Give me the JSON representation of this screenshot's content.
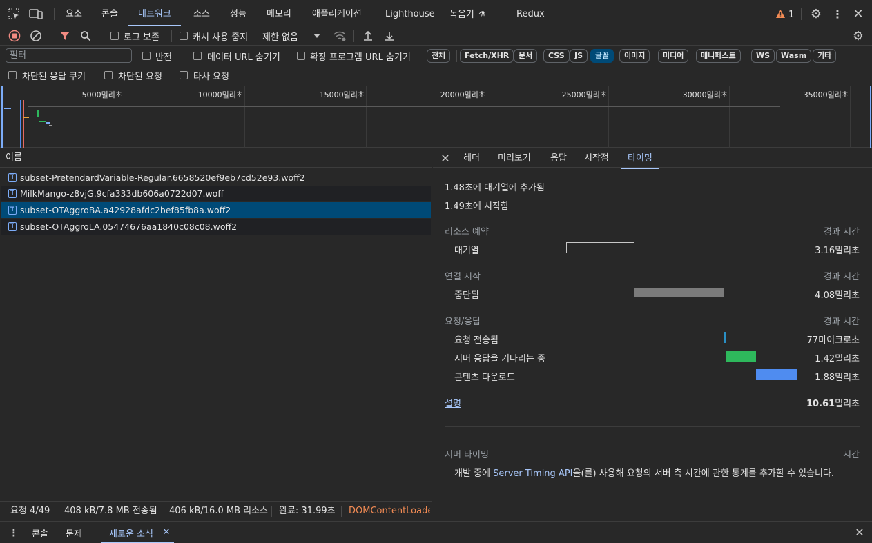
{
  "top_tabs": [
    "요소",
    "콘솔",
    "네트워크",
    "소스",
    "성능",
    "메모리",
    "애플리케이션",
    "Lighthouse",
    "녹음기",
    "Redux"
  ],
  "warning_count": "1",
  "toolbar": {
    "preserve_log": "로그 보존",
    "disable_cache": "캐시 사용 중지",
    "throttling": "제한 없음"
  },
  "filter": {
    "placeholder": "필터",
    "invert": "반전",
    "hide_data_urls": "데이터 URL 숨기기",
    "hide_ext_urls": "확장 프로그램 URL 숨기기",
    "types": [
      "전체",
      "Fetch/XHR",
      "문서",
      "CSS",
      "JS",
      "글꼴",
      "이미지",
      "미디어",
      "매니페스트",
      "WS",
      "Wasm",
      "기타"
    ],
    "selected_type": "글꼴",
    "blocked_cookies": "차단된 응답 쿠키",
    "blocked_requests": "차단된 요청",
    "third_party": "타사 요청"
  },
  "overview_ticks": [
    "5000밀리초",
    "10000밀리초",
    "15000밀리초",
    "20000밀리초",
    "25000밀리초",
    "30000밀리초",
    "35000밀리초"
  ],
  "list": {
    "header": "이름",
    "rows": [
      "subset-PretendardVariable-Regular.6658520ef9eb7cd52e93.woff2",
      "MilkMango-z8vjG.9cfa333db606a0722d07.woff",
      "subset-OTAggroBA.a42928afdc2bef85fb8a.woff2",
      "subset-OTAggroLA.05474676aa1840c08c08.woff2"
    ],
    "selected_index": 2
  },
  "status": {
    "requests": "요청 4/49",
    "transferred": "408 kB/7.8 MB 전송됨",
    "resources": "406 kB/16.0 MB 리소스",
    "finish": "완료: 31.99초",
    "dcl": "DOMContentLoade"
  },
  "detail": {
    "tabs": [
      "헤더",
      "미리보기",
      "응답",
      "시작점",
      "타이밍"
    ],
    "active_tab": "타이밍",
    "queued_at": "1.48초에 대기열에 추가됨",
    "started_at": "1.49초에 시작함",
    "sections": {
      "resource_scheduling": "리소스 예약",
      "connection_start": "연결 시작",
      "request_response": "요청/응답",
      "duration_label": "경과 시간"
    },
    "phases": {
      "queueing": {
        "label": "대기열",
        "value": "3.16밀리초",
        "color": "#282828"
      },
      "stalled": {
        "label": "중단됨",
        "value": "4.08밀리초",
        "color": "#7b7b7b"
      },
      "request_sent": {
        "label": "요청 전송됨",
        "value": "77마이크로초",
        "color": "#2a8fc4"
      },
      "waiting": {
        "label": "서버 응답을 기다리는 중",
        "value": "1.42밀리초",
        "color": "#2eb85c"
      },
      "download": {
        "label": "콘텐츠 다운로드",
        "value": "1.88밀리초",
        "color": "#4f8cf0"
      }
    },
    "explanation": "설명",
    "total_value": "10.61",
    "total_unit": "밀리초",
    "server_timing": "서버 타이밍",
    "time_label": "시간",
    "server_timing_pre": "개발 중에 ",
    "server_timing_link": "Server Timing API",
    "server_timing_post": "을(를) 사용해 요청의 서버 측 시간에 관한 통계를 추가할 수 있습니다."
  },
  "drawer": {
    "tabs": [
      "콘솔",
      "문제",
      "새로운 소식"
    ],
    "active_tab": "새로운 소식"
  }
}
